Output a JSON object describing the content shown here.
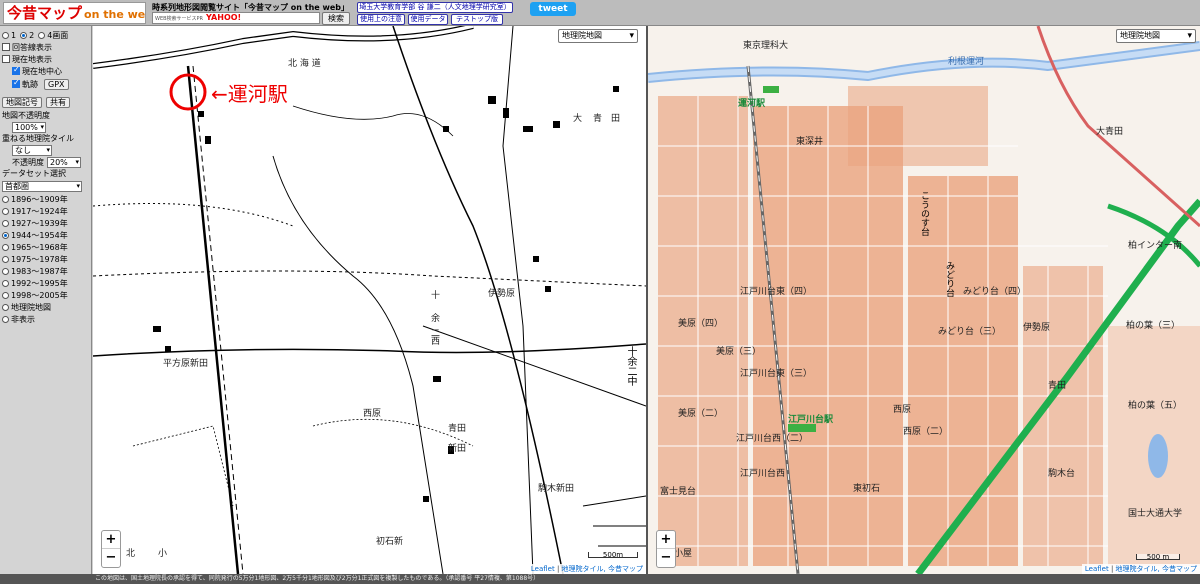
{
  "header": {
    "logo_main": "今昔マップ",
    "logo_sub": "on the web",
    "site_title": "時系列地形図閲覧サイト「今昔マップ on the web」",
    "search_logo_small": "WEB検索サービスPR",
    "search_logo": "YAHOO!",
    "search_value": "",
    "search_button": "検索",
    "buttons": [
      "埼玉大学教育学部 谷 謙二（人文地理学研究室）",
      "使用上の注意",
      "使用データ",
      "テストップ版"
    ],
    "tweet": "tweet"
  },
  "sidebar": {
    "layout_options": [
      "1",
      "2",
      "4画面"
    ],
    "layout_selected": 1,
    "checkboxes": [
      {
        "label": "回答線表示",
        "checked": false
      },
      {
        "label": "現在地表示",
        "checked": false
      },
      {
        "label": "現在地中心",
        "checked": true
      },
      {
        "label": "軌跡",
        "checked": true
      }
    ],
    "gpx_button": "GPX",
    "map_symbol_button": "地図記号",
    "share_button": "共有",
    "opacity_label": "地図不透明度",
    "opacity_value": "100%",
    "overlay_label": "重ねる地理院タイル",
    "overlay_value": "なし",
    "overlay_opacity_label": "不透明度",
    "overlay_opacity_value": "20%",
    "dataset_label": "データセット選択",
    "dataset_value": "首都圏",
    "periods": [
      "1896〜1909年",
      "1917〜1924年",
      "1927〜1939年",
      "1944〜1954年",
      "1965〜1968年",
      "1975〜1978年",
      "1983〜1987年",
      "1992〜1995年",
      "1998〜2005年",
      "地理院地図",
      "非表示"
    ],
    "period_selected": 3
  },
  "left_map": {
    "layer_select": "地理院地図",
    "annotation": "←運河駅",
    "labels_h": [
      "北 海 道",
      "大",
      "青",
      "田",
      "伊勢原",
      "平方原新田",
      "十",
      "余",
      "二",
      "西",
      "西原",
      "青田",
      "新田",
      "初石新",
      "駒木新田",
      "小",
      "北"
    ],
    "labels_v": [
      "十余二中"
    ],
    "scale": "500m",
    "attribution_lib": "Leaflet",
    "attribution_src": "地理院タイル, 今昔マップ"
  },
  "right_map": {
    "layer_select": "地理院地図",
    "labels": [
      "東京理科大",
      "運河駅",
      "東深井",
      "大青田",
      "こうのす台",
      "みどり台",
      "江戸川台東（四）",
      "みどり台（四）",
      "みどり台（三）",
      "伊勢原",
      "美原（三）",
      "美原（四）",
      "江戸川台東（三）",
      "美原（二）",
      "青田",
      "西原",
      "江戸川台駅",
      "江戸川台西（二）",
      "西原（二）",
      "柏の葉（三）",
      "柏の葉（五）",
      "柏インター南",
      "利根運河",
      "富士見台",
      "東初石",
      "江戸川台西",
      "駒木台",
      "小屋",
      "国士大通大学"
    ],
    "scale": "500 m",
    "attribution_lib": "Leaflet",
    "attribution_src": "地理院タイル, 今昔マップ"
  },
  "footer": "この地図は、国土地理院長の承認を得て、同院発行の5万分1地形図、2万5千分1地形図及び2万分1正式図を複製したものである。（承認番号 平27情複、第1088号）",
  "colors": {
    "accent": "#1da1f2",
    "road": "#1faf4e",
    "station": "#3cb043",
    "block": "#e8875a"
  }
}
